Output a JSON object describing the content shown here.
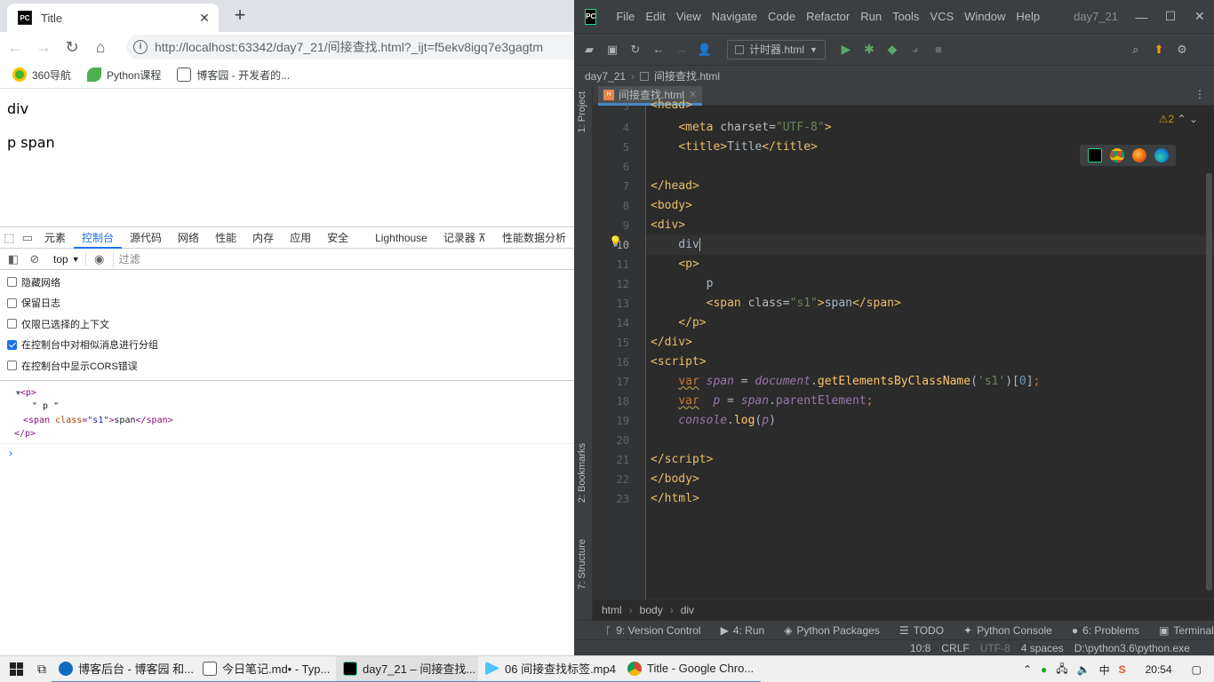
{
  "chrome": {
    "tab_title": "Title",
    "url": "http://localhost:63342/day7_21/间接查找.html?_ijt=f5ekv8igq7e3gagtm",
    "bookmarks": [
      "360导航",
      "Python课程",
      "博客园 - 开发者的..."
    ],
    "page_lines": [
      "div",
      "p span"
    ],
    "devtools": {
      "tabs": [
        "元素",
        "控制台",
        "源代码",
        "网络",
        "性能",
        "内存",
        "应用",
        "安全",
        "Lighthouse",
        "记录器 ⊼",
        "性能数据分析"
      ],
      "active_tab": "控制台",
      "context": "top",
      "filter_placeholder": "过滤",
      "settings": [
        {
          "label": "隐藏网络",
          "checked": false
        },
        {
          "label": "保留日志",
          "checked": false
        },
        {
          "label": "仅限已选择的上下文",
          "checked": false
        },
        {
          "label": "在控制台中对相似消息进行分组",
          "checked": true
        },
        {
          "label": "在控制台中显示CORS错误",
          "checked": false
        }
      ],
      "output": {
        "open": "<p>",
        "text_node": "\" p \"",
        "span_open": "<span",
        "span_attr": "class",
        "span_val": "\"s1\"",
        "span_text": "span",
        "span_close": "</span>",
        "close": "</p>"
      },
      "prompt": "›"
    }
  },
  "pycharm": {
    "menu": [
      "File",
      "Edit",
      "View",
      "Navigate",
      "Code",
      "Refactor",
      "Run",
      "Tools",
      "VCS",
      "Window",
      "Help"
    ],
    "project_title": "day7_21",
    "run_config": "计时器.html",
    "breadcrumb": [
      "day7_21",
      "间接查找.html"
    ],
    "editor_tab": "间接查找.html",
    "warnings": "⚠2",
    "line_numbers": [
      "3",
      "4",
      "5",
      "6",
      "7",
      "8",
      "9",
      "10",
      "11",
      "12",
      "13",
      "14",
      "15",
      "16",
      "17",
      "18",
      "19",
      "20",
      "21",
      "22",
      "23"
    ],
    "current_line": "10",
    "side_tools": [
      "1: Project",
      "2: Bookmarks",
      "7: Structure"
    ],
    "bottom_breadcrumb": [
      "html",
      "body",
      "div"
    ],
    "tool_windows": [
      "9: Version Control",
      "4: Run",
      "Python Packages",
      "TODO",
      "Python Console",
      "6: Problems",
      "Terminal"
    ],
    "status": {
      "position": "10:8",
      "line_sep": "CRLF",
      "encoding": "UTF-8",
      "indent": "4 spaces",
      "interpreter": "D:\\python3.6\\python.exe"
    }
  },
  "taskbar": {
    "items": [
      {
        "label": "博客后台 - 博客园 和...",
        "color": "#0f6cbd"
      },
      {
        "label": "今日笔记.md• - Typ...",
        "color": "#555555"
      },
      {
        "label": "day7_21 – 间接查找...",
        "color": "#21d789"
      },
      {
        "label": "06 间接查找标签.mp4",
        "color": "#4cc2ff"
      },
      {
        "label": "Title - Google Chro...",
        "color": "#db4437"
      }
    ],
    "time": "20:54"
  }
}
